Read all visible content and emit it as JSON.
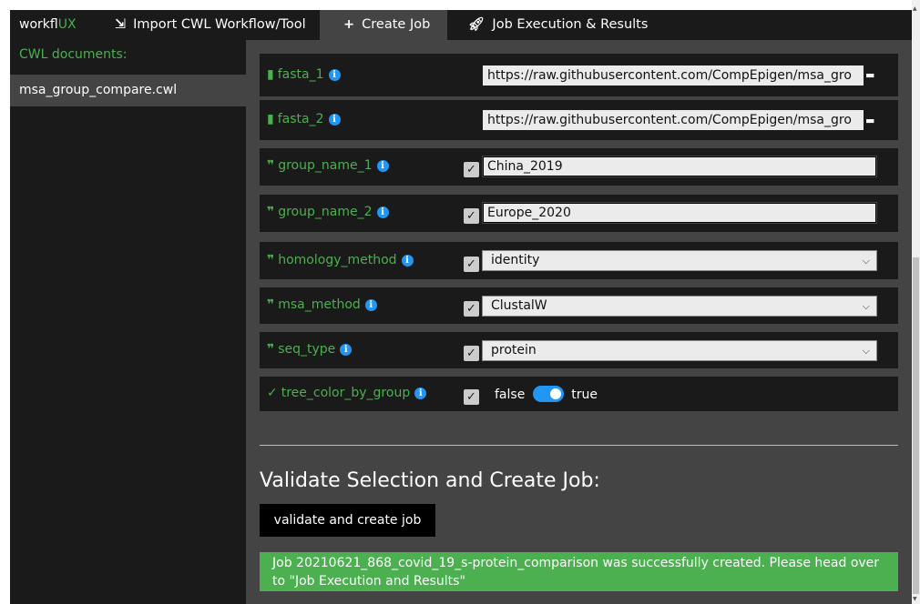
{
  "brand": {
    "prefix": "workfl",
    "suffix": "UX"
  },
  "nav": {
    "import": {
      "icon": "import-icon",
      "label": "Import CWL Workflow/Tool"
    },
    "create": {
      "icon": "plus-icon",
      "label": "Create Job"
    },
    "execution": {
      "icon": "rocket-icon",
      "label": "Job Execution & Results"
    }
  },
  "sidebar": {
    "heading": "CWL documents:",
    "items": [
      {
        "label": "msa_group_compare.cwl"
      }
    ]
  },
  "params": [
    {
      "name": "fasta_1",
      "type_icon": "file-icon",
      "value": "https://raw.githubusercontent.com/CompEpigen/msa_gro"
    },
    {
      "name": "fasta_2",
      "type_icon": "file-icon",
      "value": "https://raw.githubusercontent.com/CompEpigen/msa_gro"
    },
    {
      "name": "group_name_1",
      "type_icon": "quote-icon",
      "checked": true,
      "value": "China_2019"
    },
    {
      "name": "group_name_2",
      "type_icon": "quote-icon",
      "checked": true,
      "value": "Europe_2020"
    },
    {
      "name": "homology_method",
      "type_icon": "quote-icon",
      "checked": true,
      "value": "identity"
    },
    {
      "name": "msa_method",
      "type_icon": "quote-icon",
      "checked": true,
      "value": "ClustalW"
    },
    {
      "name": "seq_type",
      "type_icon": "quote-icon",
      "checked": true,
      "value": "protein"
    },
    {
      "name": "tree_color_by_group",
      "type_icon": "check-icon",
      "checked": true,
      "false_label": "false",
      "true_label": "true",
      "value": true
    }
  ],
  "validate": {
    "title": "Validate Selection and Create Job:",
    "button_label": "validate and create job",
    "success_message": "Job 20210621_868_covid_19_s-protein_comparison was successfully created. Please head over to \"Job Execution and Results\""
  },
  "colors": {
    "accent": "#4caf50",
    "info": "#2196f3",
    "panel": "#1a1a1a",
    "background": "#444444"
  }
}
